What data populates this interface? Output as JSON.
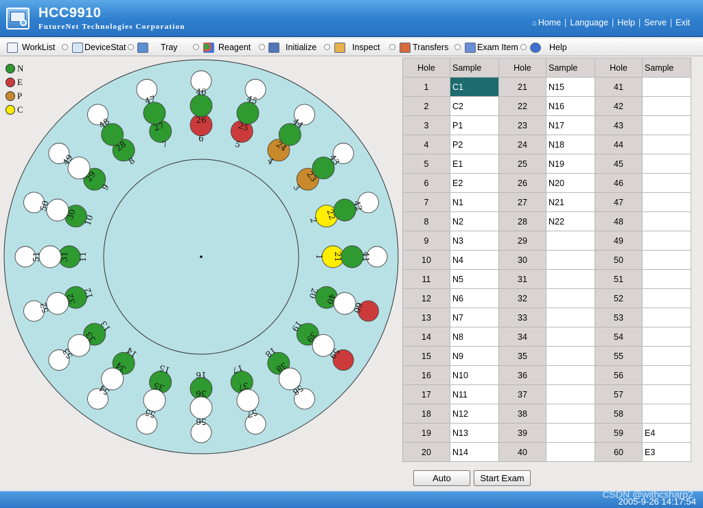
{
  "header": {
    "app_title": "HCC9910",
    "company": "FutureNet Technologies Corporation",
    "nav": [
      {
        "label": "Home",
        "icon": "home-icon"
      },
      {
        "label": "Language"
      },
      {
        "label": "Help"
      },
      {
        "label": "Serve"
      },
      {
        "label": "Exit"
      }
    ]
  },
  "toolbar": {
    "items": [
      {
        "label": "WorkList",
        "icon": "worklist-icon"
      },
      {
        "label": "DeviceStat",
        "icon": "device-status-icon"
      },
      {
        "label": "Tray",
        "icon": "tray-icon"
      },
      {
        "label": "Reagent",
        "icon": "reagent-icon"
      },
      {
        "label": "Initialize",
        "icon": "initialize-icon"
      },
      {
        "label": "Inspect",
        "icon": "inspect-icon"
      },
      {
        "label": "Transfers",
        "icon": "transfers-icon"
      },
      {
        "label": "Exam Item",
        "icon": "exam-item-icon"
      },
      {
        "label": "Help",
        "icon": "help-icon"
      }
    ]
  },
  "legend": [
    {
      "code": "N",
      "color": "#2e9a30"
    },
    {
      "code": "E",
      "color": "#cc3b3b"
    },
    {
      "code": "P",
      "color": "#c98a2c"
    },
    {
      "code": "C",
      "color": "#ffee00"
    }
  ],
  "tray": {
    "colors": {
      "plate": "#b8e1e5",
      "empty": "#ffffff",
      "N": "#2e9a30",
      "E": "#cc3b3b",
      "P": "#c98a2c",
      "C": "#ffee00"
    },
    "inner_ring": [
      "C",
      "C",
      "P",
      "P",
      "E",
      "E",
      "N",
      "N",
      "N",
      "N",
      "N",
      "N",
      "N",
      "N",
      "N",
      "N",
      "N",
      "N",
      "N",
      "N"
    ],
    "middle_ring": [
      "N",
      "N",
      "N",
      "N",
      "N",
      "N",
      "N",
      "N",
      "",
      "",
      "",
      "",
      "",
      "",
      "",
      "",
      "",
      "",
      "",
      ""
    ],
    "outer_ring": [
      "",
      "",
      "",
      "",
      "",
      "",
      "",
      "",
      "",
      "",
      "",
      "",
      "",
      "",
      "",
      "",
      "",
      "",
      "E",
      "E"
    ]
  },
  "table": {
    "headers": [
      "Hole",
      "Sample",
      "Hole",
      "Sample",
      "Hole",
      "Sample"
    ],
    "rows": [
      [
        "1",
        "C1",
        "21",
        "N15",
        "41",
        ""
      ],
      [
        "2",
        "C2",
        "22",
        "N16",
        "42",
        ""
      ],
      [
        "3",
        "P1",
        "23",
        "N17",
        "43",
        ""
      ],
      [
        "4",
        "P2",
        "24",
        "N18",
        "44",
        ""
      ],
      [
        "5",
        "E1",
        "25",
        "N19",
        "45",
        ""
      ],
      [
        "6",
        "E2",
        "26",
        "N20",
        "46",
        ""
      ],
      [
        "7",
        "N1",
        "27",
        "N21",
        "47",
        ""
      ],
      [
        "8",
        "N2",
        "28",
        "N22",
        "48",
        ""
      ],
      [
        "9",
        "N3",
        "29",
        "",
        "49",
        ""
      ],
      [
        "10",
        "N4",
        "30",
        "",
        "50",
        ""
      ],
      [
        "11",
        "N5",
        "31",
        "",
        "51",
        ""
      ],
      [
        "12",
        "N6",
        "32",
        "",
        "52",
        ""
      ],
      [
        "13",
        "N7",
        "33",
        "",
        "53",
        ""
      ],
      [
        "14",
        "N8",
        "34",
        "",
        "54",
        ""
      ],
      [
        "15",
        "N9",
        "35",
        "",
        "55",
        ""
      ],
      [
        "16",
        "N10",
        "36",
        "",
        "56",
        ""
      ],
      [
        "17",
        "N11",
        "37",
        "",
        "57",
        ""
      ],
      [
        "18",
        "N12",
        "38",
        "",
        "58",
        ""
      ],
      [
        "19",
        "N13",
        "39",
        "",
        "59",
        "E4"
      ],
      [
        "20",
        "N14",
        "40",
        "",
        "60",
        "E3"
      ]
    ]
  },
  "buttons": {
    "auto": "Auto",
    "start_exam": "Start Exam"
  },
  "status": {
    "datetime": "2005-9-26 14:17:54",
    "watermark": "CSDN @withcsharp2"
  }
}
